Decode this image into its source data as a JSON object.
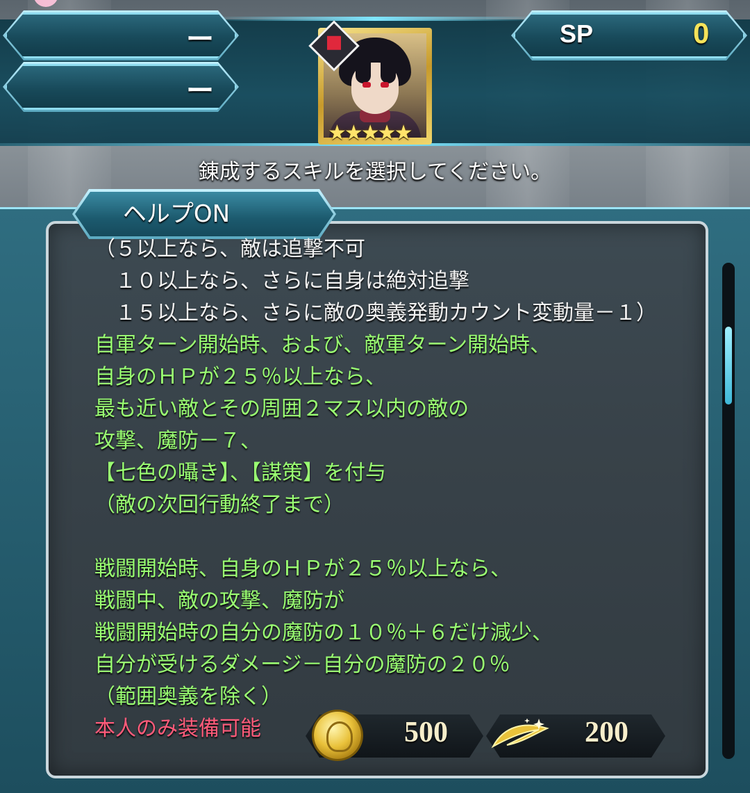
{
  "header": {
    "stat_1_value": "ー",
    "stat_2_value": "ー",
    "sp_label": "SP",
    "sp_value": "0",
    "rarity_stars": "★★★★★"
  },
  "instruction": "錬成するスキルを選択してください。",
  "help_button": {
    "label": "ヘルプON"
  },
  "description": {
    "lines": [
      {
        "text": "（５以上なら、敵は追撃不可",
        "color": "white"
      },
      {
        "text": "　１０以上なら、さらに自身は絶対追撃",
        "color": "white"
      },
      {
        "text": "　１５以上なら、さらに敵の奥義発動カウント変動量－１）",
        "color": "white"
      },
      {
        "text": "自軍ターン開始時、および、敵軍ターン開始時、",
        "color": "green"
      },
      {
        "text": "自身のＨＰが２５％以上なら、",
        "color": "green"
      },
      {
        "text": "最も近い敵とその周囲２マス以内の敵の",
        "color": "green"
      },
      {
        "text": "攻撃、魔防－７、",
        "color": "green"
      },
      {
        "text": "【七色の囁き】、【謀策】を付与",
        "color": "green"
      },
      {
        "text": "（敵の次回行動終了まで）",
        "color": "green"
      },
      {
        "text": "",
        "color": "green"
      },
      {
        "text": "戦闘開始時、自身のＨＰが２５％以上なら、",
        "color": "green"
      },
      {
        "text": "戦闘中、敵の攻撃、魔防が",
        "color": "green"
      },
      {
        "text": "戦闘開始時の自分の魔防の１０％＋６だけ減少、",
        "color": "green"
      },
      {
        "text": "自分が受けるダメージ－自分の魔防の２０％",
        "color": "green"
      },
      {
        "text": "（範囲奥義を除く）",
        "color": "green"
      },
      {
        "text": "本人のみ装備可能",
        "color": "red"
      }
    ]
  },
  "costs": {
    "coin_icon": "gold-coin-icon",
    "coin_value": "500",
    "feather_icon": "divine-dew-icon",
    "feather_value": "200"
  },
  "colors": {
    "accent": "#7fe6ff",
    "effect_text": "#9aff72",
    "restriction_text": "#ff5b7a",
    "sp_value": "#f5e35a"
  }
}
